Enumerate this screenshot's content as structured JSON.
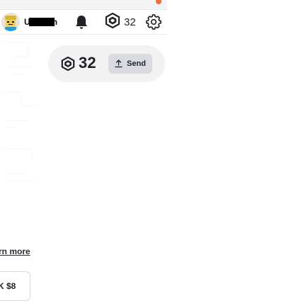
{
  "header": {
    "username": "U",
    "robux_amount": "32",
    "icons": {
      "notifications": "bell-icon",
      "robux": "robux-icon",
      "settings": "gear-icon"
    }
  },
  "balance": {
    "amount": "32",
    "send_label": "Send",
    "send_icon": "upload-icon"
  },
  "links": {
    "learn_more": "rn more"
  },
  "bottom_box": {
    "text": "K $8"
  },
  "colors": {
    "pill_background": "#f2f2f3",
    "send_button": "#d9dbe0",
    "text": "#1f2328",
    "notification_badge": "#f26d3d"
  }
}
